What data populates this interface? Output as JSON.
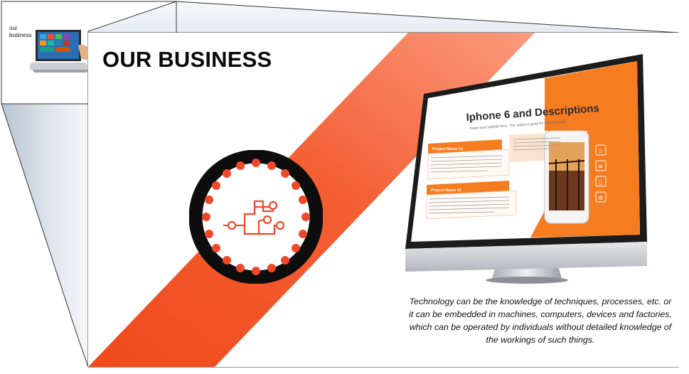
{
  "thumbnail": {
    "label_line1": "our",
    "label_line2": "business"
  },
  "slide": {
    "title": "OUR BUSINESS",
    "body": "Technology can be the knowledge of techniques, processes, etc. or it can be embedded in machines, computers, devices and factories, which can be operated by individuals without detailed knowledge of the workings of such things."
  },
  "monitor_screen": {
    "heading": "Iphone 6 and Descriptions",
    "subtitle": "Insert your subtitle here. This space is good for insert subtitle",
    "project1": "Project Name #1",
    "project2": "Project Name #2",
    "lorem": "Lorem ipsum dolor sit amet, consectetur adipiscing elit. Suspendisse efficitur ipsum vel rutrum fermentum. Donec dapibus suscipit tincidunt. Phasellus suscipit, sem eu viverra imperdiet, magna diam porta tellus, blandit tincidunt arcu risus ut tortor. Sed vehicula, risus eget mollis consequat"
  },
  "colors": {
    "accent_orange": "#f25a23",
    "stripe_light": "#f98a6a",
    "icon_red": "#f0492a",
    "ring_black": "#0d0d0d",
    "monitor_orange": "#f57c1f"
  },
  "icons": [
    "laptop-touch-icon",
    "circuit-icon",
    "star-icon",
    "mail-icon",
    "phone-icon",
    "gear-icon"
  ]
}
